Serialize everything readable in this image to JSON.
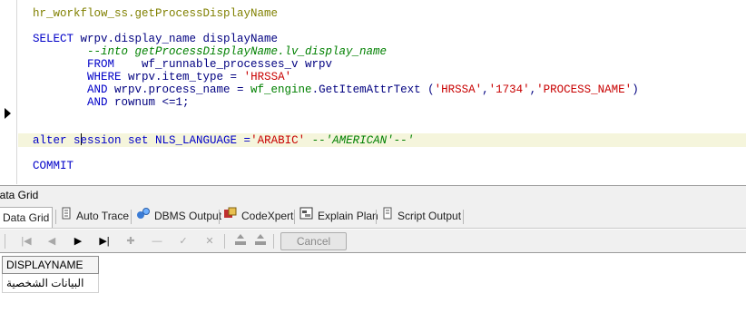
{
  "editor": {
    "lines": {
      "l1": "hr_workflow_ss.getProcessDisplayName",
      "l3a": "SELECT",
      "l3b": " wrpv.display_name displayName",
      "l4": "        --into getProcessDisplayName.lv_display_name",
      "l5a": "        FROM",
      "l5b": "    wf_runnable_processes_v wrpv",
      "l6a": "        WHERE",
      "l6b": " wrpv.item_type = ",
      "l6c": "'HRSSA'",
      "l7a": "        AND",
      "l7b": " wrpv.process_name = ",
      "l7c": "wf_engine",
      "l7d": ".GetItemAttrText (",
      "l7e": "'HRSSA'",
      "l7f": ",",
      "l7g": "'1734'",
      "l7h": ",",
      "l7i": "'PROCESS_NAME'",
      "l7j": ")",
      "l8a": "        AND",
      "l8b": " rownum ",
      "l8c": "<=1;",
      "l10a": "alter ",
      "l10b": "s",
      "l10c": "ession set NLS_LANGUAGE =",
      "l10d": "'ARABIC'",
      "l10e": " --'AMERICAN'--'",
      "l12": "COMMIT"
    }
  },
  "panel": {
    "title": "Data Grid"
  },
  "tabs": [
    {
      "label": "Data Grid",
      "icon": "grid-icon"
    },
    {
      "label": "Auto Trace",
      "icon": "document-icon"
    },
    {
      "label": "DBMS Output",
      "icon": "output-icon"
    },
    {
      "label": "CodeXpert",
      "icon": "codexpert-icon"
    },
    {
      "label": "Explain Plan",
      "icon": "explain-plan-icon"
    },
    {
      "label": "Script Output",
      "icon": "script-icon"
    }
  ],
  "navbar": {
    "cancel_label": "Cancel",
    "buttons": [
      "first-record-icon",
      "prior-record-icon",
      "next-record-icon",
      "last-record-icon",
      "insert-record-icon",
      "delete-record-icon",
      "post-edit-icon",
      "cancel-edit-icon",
      "export-icon",
      "import-icon"
    ]
  },
  "grid": {
    "columns": [
      "DISPLAYNAME"
    ],
    "rows": [
      [
        "البيانات الشخصية"
      ]
    ]
  },
  "colors": {
    "keyword": "#0000c8",
    "string": "#c80000",
    "comment": "#008000",
    "current_line": "#f5f5dc"
  }
}
